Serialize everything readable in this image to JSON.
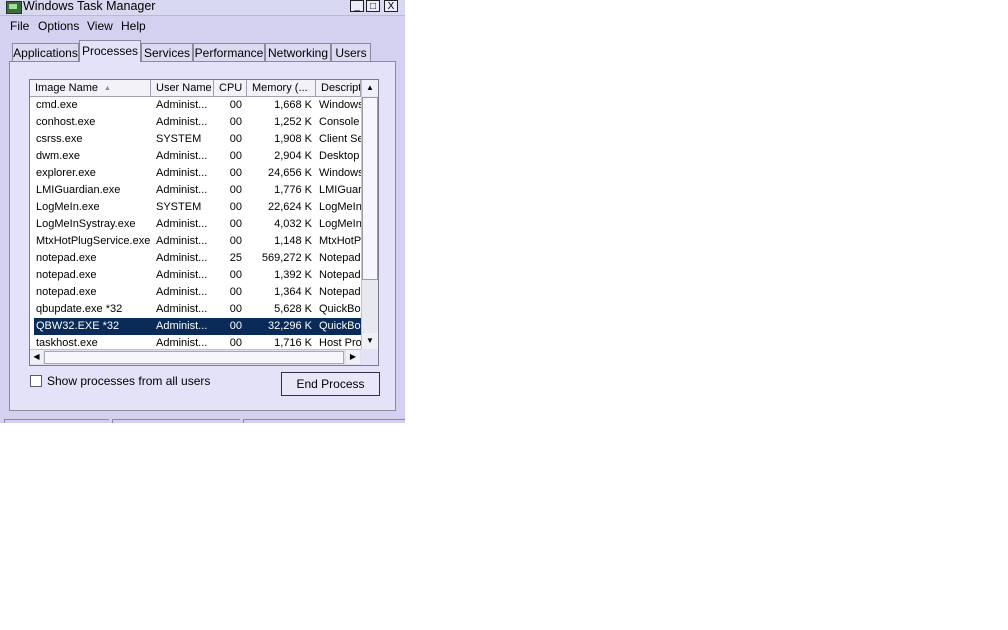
{
  "window": {
    "title": "Windows Task Manager",
    "minimize_label": "_",
    "maximize_label": "□",
    "close_label": "X"
  },
  "menu": [
    "File",
    "Options",
    "View",
    "Help"
  ],
  "tabs": [
    {
      "label": "Applications",
      "active": false
    },
    {
      "label": "Processes",
      "active": true
    },
    {
      "label": "Services",
      "active": false
    },
    {
      "label": "Performance",
      "active": false
    },
    {
      "label": "Networking",
      "active": false
    },
    {
      "label": "Users",
      "active": false
    }
  ],
  "columns": [
    "Image Name",
    "User Name",
    "CPU",
    "Memory (...",
    "Descript"
  ],
  "sort_indicator": "▲",
  "processes": [
    {
      "name": "cmd.exe",
      "user": "Administ...",
      "cpu": "00",
      "mem": "1,668 K",
      "desc": "Windows"
    },
    {
      "name": "conhost.exe",
      "user": "Administ...",
      "cpu": "00",
      "mem": "1,252 K",
      "desc": "Console"
    },
    {
      "name": "csrss.exe",
      "user": "SYSTEM",
      "cpu": "00",
      "mem": "1,908 K",
      "desc": "Client Se"
    },
    {
      "name": "dwm.exe",
      "user": "Administ...",
      "cpu": "00",
      "mem": "2,904 K",
      "desc": "Desktop"
    },
    {
      "name": "explorer.exe",
      "user": "Administ...",
      "cpu": "00",
      "mem": "24,656 K",
      "desc": "Windows"
    },
    {
      "name": "LMIGuardian.exe",
      "user": "Administ...",
      "cpu": "00",
      "mem": "1,776 K",
      "desc": "LMIGuar"
    },
    {
      "name": "LogMeIn.exe",
      "user": "SYSTEM",
      "cpu": "00",
      "mem": "22,624 K",
      "desc": "LogMeIn"
    },
    {
      "name": "LogMeInSystray.exe",
      "user": "Administ...",
      "cpu": "00",
      "mem": "4,032 K",
      "desc": "LogMeIn"
    },
    {
      "name": "MtxHotPlugService.exe",
      "user": "Administ...",
      "cpu": "00",
      "mem": "1,148 K",
      "desc": "MtxHotP"
    },
    {
      "name": "notepad.exe",
      "user": "Administ...",
      "cpu": "25",
      "mem": "569,272 K",
      "desc": "Notepad"
    },
    {
      "name": "notepad.exe",
      "user": "Administ...",
      "cpu": "00",
      "mem": "1,392 K",
      "desc": "Notepad"
    },
    {
      "name": "notepad.exe",
      "user": "Administ...",
      "cpu": "00",
      "mem": "1,364 K",
      "desc": "Notepad"
    },
    {
      "name": "qbupdate.exe *32",
      "user": "Administ...",
      "cpu": "00",
      "mem": "5,628 K",
      "desc": "QuickBoo"
    },
    {
      "name": "QBW32.EXE *32",
      "user": "Administ...",
      "cpu": "00",
      "mem": "32,296 K",
      "desc": "QuickBoo",
      "selected": true
    },
    {
      "name": "taskhost.exe",
      "user": "Administ...",
      "cpu": "00",
      "mem": "1,716 K",
      "desc": "Host Pro"
    }
  ],
  "show_all_label": "Show processes from all users",
  "end_process_label": "End Process",
  "colors": {
    "selection": "#0a2a57",
    "window_bg": "#d4d0f0"
  }
}
